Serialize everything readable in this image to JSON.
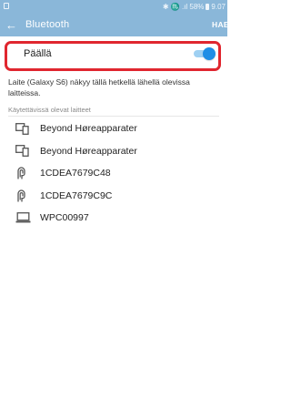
{
  "status_bar": {
    "indicators": "✱ ♏ .ıl 58%",
    "time": "9.07"
  },
  "header": {
    "back_icon": "arrow-left-icon",
    "title": "Bluetooth",
    "scan_label": "HAE"
  },
  "toggle": {
    "label": "Päällä",
    "state": "on",
    "accent_color": "#1e8ee6",
    "highlight_color": "#e0262f"
  },
  "info_text": "Laite (Galaxy S6) näkyy tällä hetkellä lähellä olevissa laitteissa.",
  "section_title": "Käytettävissä olevat laitteet",
  "devices": [
    {
      "name": "Beyond Høreapparater",
      "icon": "dual-device-icon"
    },
    {
      "name": "Beyond Høreapparater",
      "icon": "dual-device-icon"
    },
    {
      "name": "1CDEA7679C48",
      "icon": "hearing-aid-icon"
    },
    {
      "name": "1CDEA7679C9C",
      "icon": "hearing-aid-icon"
    },
    {
      "name": "WPC00997",
      "icon": "laptop-icon"
    }
  ],
  "colors": {
    "app_bar": "#8ab7d9"
  }
}
